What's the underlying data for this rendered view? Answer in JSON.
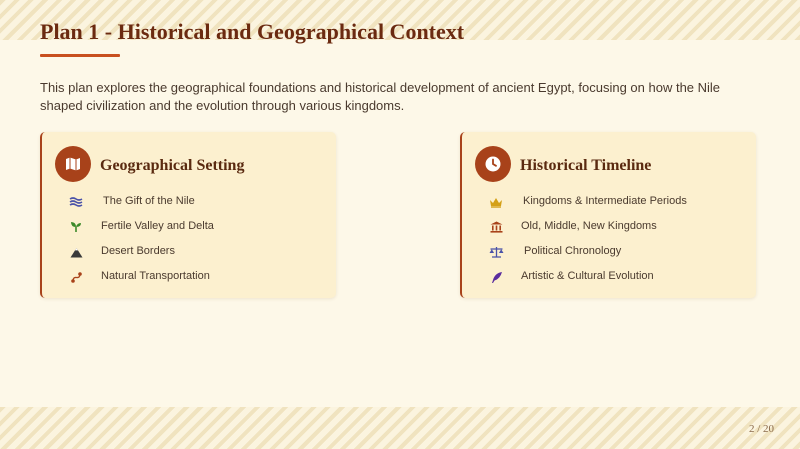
{
  "slide": {
    "title": "Plan 1 - Historical and Geographical Context",
    "intro": "This plan explores the geographical foundations and historical development of ancient Egypt, focusing on how the Nile shaped civilization and the evolution through various kingdoms.",
    "page_indicator": "2 / 20"
  },
  "cards": [
    {
      "title": "Geographical Setting",
      "icon": "map-icon",
      "items": [
        {
          "label": "The Gift of the Nile",
          "icon": "water-icon"
        },
        {
          "label": "Fertile Valley and Delta",
          "icon": "seedling-icon"
        },
        {
          "label": "Desert Borders",
          "icon": "mountain-icon"
        },
        {
          "label": "Natural Transportation",
          "icon": "route-icon"
        }
      ]
    },
    {
      "title": "Historical Timeline",
      "icon": "clock-icon",
      "items": [
        {
          "label": "Kingdoms & Intermediate Periods",
          "icon": "crown-icon"
        },
        {
          "label": "Old, Middle, New Kingdoms",
          "icon": "landmark-icon"
        },
        {
          "label": "Political Chronology",
          "icon": "balance-scale-icon"
        },
        {
          "label": "Artistic & Cultural Evolution",
          "icon": "feather-icon"
        }
      ]
    }
  ],
  "colors": {
    "background": "#fdf8e8",
    "title": "#6b2a10",
    "accent": "#a8421a",
    "card_background": "#fcf0cf"
  }
}
